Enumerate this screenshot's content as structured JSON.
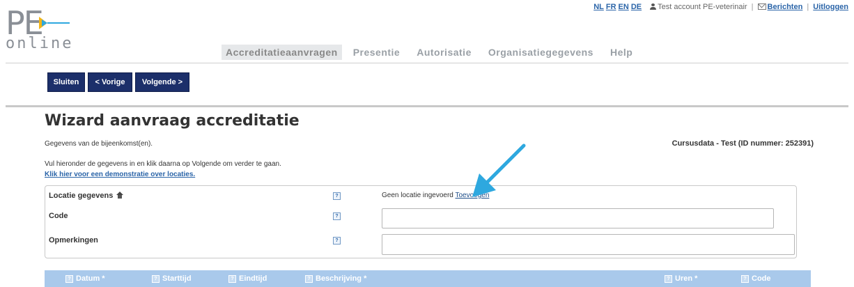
{
  "header": {
    "languages": [
      "NL",
      "FR",
      "EN",
      "DE"
    ],
    "account": "Test account PE-veterinair",
    "messages_label": "Berichten",
    "logout_label": "Uitloggen"
  },
  "logo": {
    "pe": "PE",
    "online": "online"
  },
  "nav": {
    "tabs": [
      {
        "label": "Accreditatieaanvragen",
        "active": true
      },
      {
        "label": "Presentie"
      },
      {
        "label": "Autorisatie"
      },
      {
        "label": "Organisatiegegevens"
      },
      {
        "label": "Help"
      }
    ]
  },
  "toolbar": {
    "close_label": "Sluiten",
    "prev_label": "< Vorige",
    "next_label": "Volgende >"
  },
  "page": {
    "title": "Wizard aanvraag accreditatie",
    "subtitle": "Gegevens van de bijeenkomst(en).",
    "course_info": "Cursusdata - Test (ID nummer: 252391)",
    "instruction": "Vul hieronder de gegevens in en klik daarna op Volgende om verder te gaan.",
    "demo_link": "Klik hier voor een demonstratie over locaties."
  },
  "form": {
    "location_label": "Locatie gegevens",
    "no_location_text": "Geen locatie ingevoerd",
    "add_link": "Toevoegen",
    "code_label": "Code",
    "code_value": "",
    "remarks_label": "Opmerkingen",
    "remarks_value": "",
    "help_glyph": "?"
  },
  "table": {
    "columns": [
      "Datum *",
      "Starttijd",
      "Eindtijd",
      "Beschrijving *",
      "Uren *",
      "Code"
    ]
  },
  "colors": {
    "brand_navy": "#1c2f6a",
    "link": "#2a64a8",
    "table_header": "#a9c9eb",
    "arrow": "#2ea8df"
  }
}
